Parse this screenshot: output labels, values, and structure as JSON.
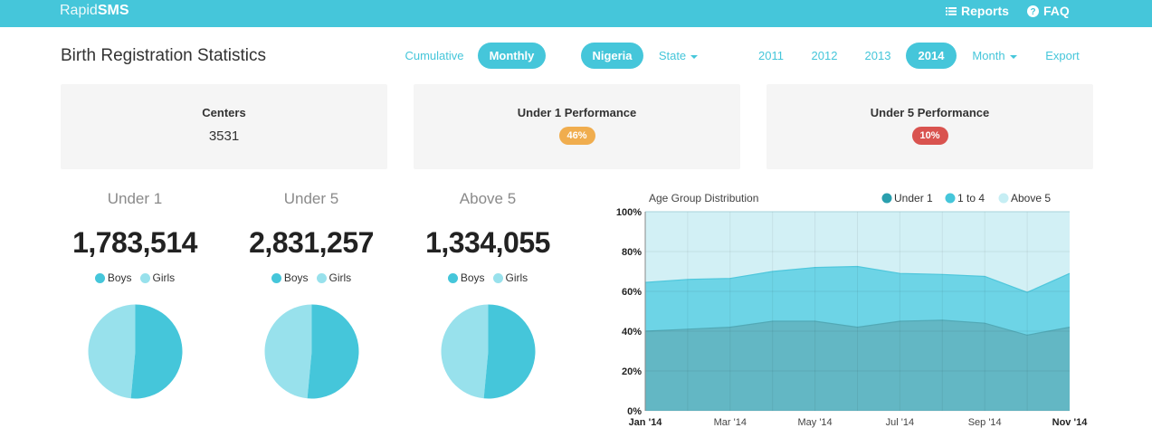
{
  "navbar": {
    "brand_light": "Rapid",
    "brand_bold": "SMS",
    "reports": "Reports",
    "faq": "FAQ"
  },
  "page_title": "Birth Registration Statistics",
  "filters": {
    "cumulative": "Cumulative",
    "monthly": "Monthly",
    "nigeria": "Nigeria",
    "state": "State",
    "years": [
      "2011",
      "2012",
      "2013",
      "2014"
    ],
    "month": "Month",
    "export": "Export"
  },
  "stats": {
    "centers_label": "Centers",
    "centers_value": "3531",
    "u1_label": "Under 1 Performance",
    "u1_badge": "46%",
    "u5_label": "Under 5 Performance",
    "u5_badge": "10%"
  },
  "age_groups": [
    {
      "title": "Under 1",
      "value": "1,783,514",
      "boys_label": "Boys",
      "girls_label": "Girls",
      "boys_pct": 51.5,
      "girls_pct": 48.5
    },
    {
      "title": "Under 5",
      "value": "2,831,257",
      "boys_label": "Boys",
      "girls_label": "Girls",
      "boys_pct": 51.5,
      "girls_pct": 48.5
    },
    {
      "title": "Above 5",
      "value": "1,334,055",
      "boys_label": "Boys",
      "girls_label": "Girls",
      "boys_pct": 51.5,
      "girls_pct": 48.5
    }
  ],
  "colors": {
    "accent": "#45c6da",
    "boys": "#45c6da",
    "girls": "#98e1ec",
    "badge_orange": "#f0ad4e",
    "badge_red": "#d9534f",
    "under1": "#63b7c4",
    "one_to_four": "#6dd4e6",
    "above5": "#d2f0f5"
  },
  "chart_data": {
    "type": "area",
    "title": "Age Group Distribution",
    "stacked": true,
    "x": [
      "Jan '14",
      "Feb '14",
      "Mar '14",
      "Apr '14",
      "May '14",
      "Jun '14",
      "Jul '14",
      "Aug '14",
      "Sep '14",
      "Oct '14",
      "Nov '14"
    ],
    "tick_labels": [
      "Jan '14",
      "Mar '14",
      "May '14",
      "Jul '14",
      "Sep '14",
      "Nov '14"
    ],
    "series": [
      {
        "name": "Under 1",
        "values": [
          40,
          41,
          42,
          45,
          45,
          42,
          45,
          45.5,
          44,
          38,
          42
        ]
      },
      {
        "name": "1 to 4",
        "values": [
          24.5,
          25,
          24.5,
          25,
          27,
          30.5,
          24,
          23,
          23.5,
          21.5,
          27
        ]
      },
      {
        "name": "Above 5",
        "values": [
          35.5,
          34,
          33.5,
          30,
          28,
          27.5,
          31,
          31.5,
          32.5,
          40.5,
          31
        ]
      }
    ],
    "yticks": [
      "0%",
      "20%",
      "40%",
      "60%",
      "80%",
      "100%"
    ],
    "ylim": [
      0,
      100
    ],
    "legend": "top-right",
    "grid": true
  }
}
